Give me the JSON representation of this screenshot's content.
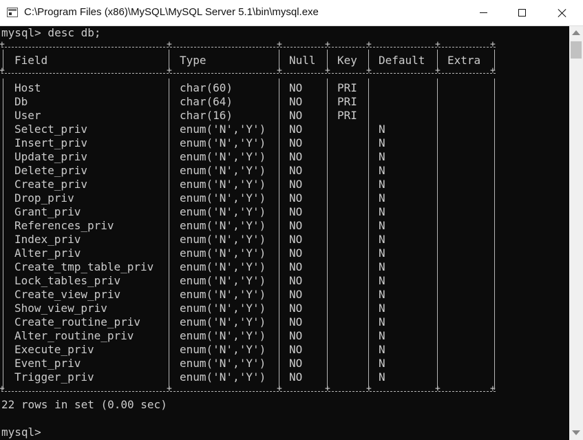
{
  "window": {
    "title": "C:\\Program Files (x86)\\MySQL\\MySQL Server 5.1\\bin\\mysql.exe"
  },
  "console": {
    "command_line": "mysql> desc db;",
    "headers": [
      "Field",
      "Type",
      "Null",
      "Key",
      "Default",
      "Extra"
    ],
    "rows": [
      [
        "Host",
        "char(60)",
        "NO",
        "PRI",
        "",
        ""
      ],
      [
        "Db",
        "char(64)",
        "NO",
        "PRI",
        "",
        ""
      ],
      [
        "User",
        "char(16)",
        "NO",
        "PRI",
        "",
        ""
      ],
      [
        "Select_priv",
        "enum('N','Y')",
        "NO",
        "",
        "N",
        ""
      ],
      [
        "Insert_priv",
        "enum('N','Y')",
        "NO",
        "",
        "N",
        ""
      ],
      [
        "Update_priv",
        "enum('N','Y')",
        "NO",
        "",
        "N",
        ""
      ],
      [
        "Delete_priv",
        "enum('N','Y')",
        "NO",
        "",
        "N",
        ""
      ],
      [
        "Create_priv",
        "enum('N','Y')",
        "NO",
        "",
        "N",
        ""
      ],
      [
        "Drop_priv",
        "enum('N','Y')",
        "NO",
        "",
        "N",
        ""
      ],
      [
        "Grant_priv",
        "enum('N','Y')",
        "NO",
        "",
        "N",
        ""
      ],
      [
        "References_priv",
        "enum('N','Y')",
        "NO",
        "",
        "N",
        ""
      ],
      [
        "Index_priv",
        "enum('N','Y')",
        "NO",
        "",
        "N",
        ""
      ],
      [
        "Alter_priv",
        "enum('N','Y')",
        "NO",
        "",
        "N",
        ""
      ],
      [
        "Create_tmp_table_priv",
        "enum('N','Y')",
        "NO",
        "",
        "N",
        ""
      ],
      [
        "Lock_tables_priv",
        "enum('N','Y')",
        "NO",
        "",
        "N",
        ""
      ],
      [
        "Create_view_priv",
        "enum('N','Y')",
        "NO",
        "",
        "N",
        ""
      ],
      [
        "Show_view_priv",
        "enum('N','Y')",
        "NO",
        "",
        "N",
        ""
      ],
      [
        "Create_routine_priv",
        "enum('N','Y')",
        "NO",
        "",
        "N",
        ""
      ],
      [
        "Alter_routine_priv",
        "enum('N','Y')",
        "NO",
        "",
        "N",
        ""
      ],
      [
        "Execute_priv",
        "enum('N','Y')",
        "NO",
        "",
        "N",
        ""
      ],
      [
        "Event_priv",
        "enum('N','Y')",
        "NO",
        "",
        "N",
        ""
      ],
      [
        "Trigger_priv",
        "enum('N','Y')",
        "NO",
        "",
        "N",
        ""
      ]
    ],
    "result_summary": "22 rows in set (0.00 sec)",
    "prompt": "mysql>"
  },
  "icons": {
    "app": "console-app-icon",
    "minimize": "minimize-icon",
    "maximize": "maximize-icon",
    "close": "close-icon"
  },
  "colors": {
    "background": "#0c0c0c",
    "text": "#cccccc",
    "titlebar": "#ffffff"
  }
}
